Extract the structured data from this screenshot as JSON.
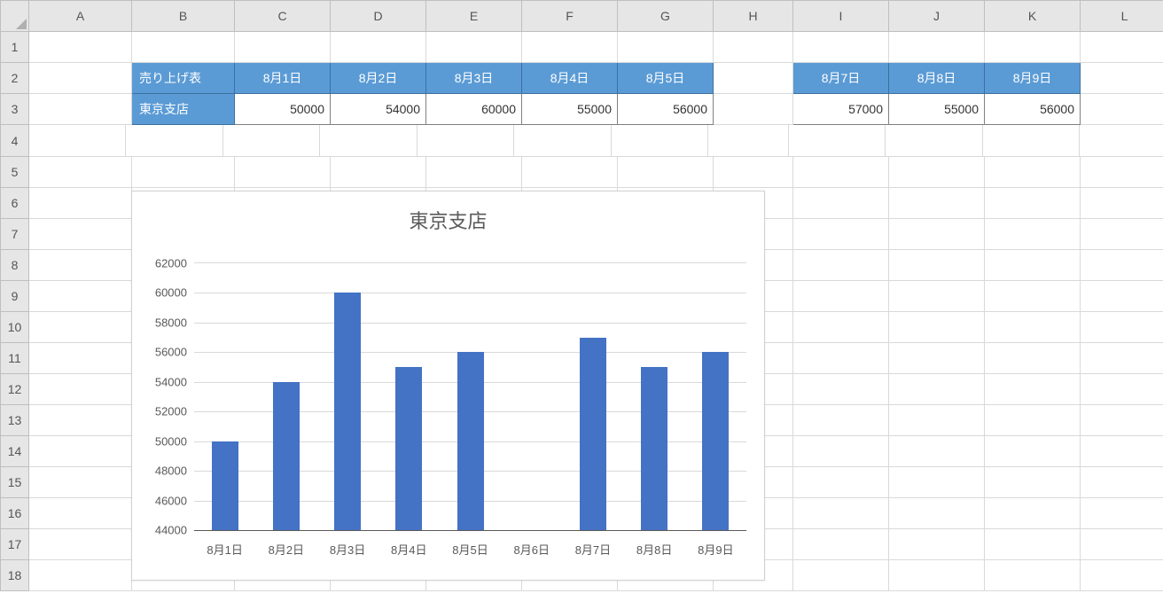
{
  "columns": [
    "A",
    "B",
    "C",
    "D",
    "E",
    "F",
    "G",
    "H",
    "I",
    "J",
    "K",
    "L"
  ],
  "rows": [
    "1",
    "2",
    "3",
    "4",
    "5",
    "6",
    "7",
    "8",
    "9",
    "10",
    "11",
    "12",
    "13",
    "14",
    "15",
    "16",
    "17",
    "18"
  ],
  "table": {
    "header_label": "売り上げ表",
    "row_label": "東京支店",
    "dates_block1": [
      "8月1日",
      "8月2日",
      "8月3日",
      "8月4日",
      "8月5日"
    ],
    "values_block1": [
      "50000",
      "54000",
      "60000",
      "55000",
      "56000"
    ],
    "dates_block2": [
      "8月7日",
      "8月8日",
      "8月9日"
    ],
    "values_block2": [
      "57000",
      "55000",
      "56000"
    ]
  },
  "chart_data": {
    "type": "bar",
    "title": "東京支店",
    "categories": [
      "8月1日",
      "8月2日",
      "8月3日",
      "8月4日",
      "8月5日",
      "8月6日",
      "8月7日",
      "8月8日",
      "8月9日"
    ],
    "values": [
      50000,
      54000,
      60000,
      55000,
      56000,
      null,
      57000,
      55000,
      56000
    ],
    "ylim": [
      44000,
      62000
    ],
    "yticks": [
      44000,
      46000,
      48000,
      50000,
      52000,
      54000,
      56000,
      58000,
      60000,
      62000
    ]
  }
}
